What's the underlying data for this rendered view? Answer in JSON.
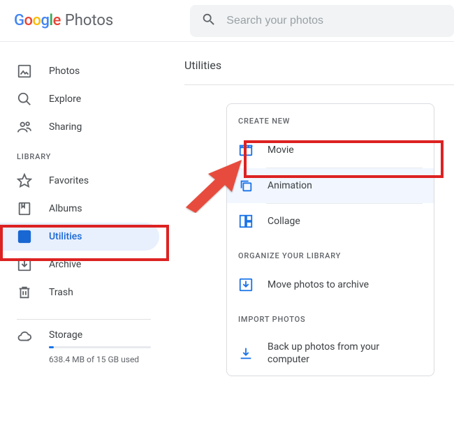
{
  "header": {
    "product_name": "Photos",
    "search_placeholder": "Search your photos"
  },
  "sidebar": {
    "items": [
      {
        "id": "photos",
        "label": "Photos",
        "icon": "image-icon"
      },
      {
        "id": "explore",
        "label": "Explore",
        "icon": "search-icon"
      },
      {
        "id": "sharing",
        "label": "Sharing",
        "icon": "people-icon"
      }
    ],
    "library_label": "LIBRARY",
    "library_items": [
      {
        "id": "favorites",
        "label": "Favorites",
        "icon": "star-icon"
      },
      {
        "id": "albums",
        "label": "Albums",
        "icon": "bookmark-icon"
      },
      {
        "id": "utilities",
        "label": "Utilities",
        "icon": "check-square-icon",
        "active": true
      },
      {
        "id": "archive",
        "label": "Archive",
        "icon": "archive-icon"
      },
      {
        "id": "trash",
        "label": "Trash",
        "icon": "trash-icon"
      }
    ],
    "storage": {
      "label": "Storage",
      "text": "638.4 MB of 15 GB used",
      "fill_pct": 5
    }
  },
  "main": {
    "title": "Utilities",
    "sections": {
      "create_new": {
        "label": "CREATE NEW",
        "items": [
          {
            "id": "movie",
            "label": "Movie",
            "icon": "clapper-icon"
          },
          {
            "id": "animation",
            "label": "Animation",
            "icon": "stack-icon",
            "highlight": true
          },
          {
            "id": "collage",
            "label": "Collage",
            "icon": "collage-icon"
          }
        ]
      },
      "organize": {
        "label": "ORGANIZE YOUR LIBRARY",
        "items": [
          {
            "id": "move-archive",
            "label": "Move photos to archive",
            "icon": "archive-down-icon"
          }
        ]
      },
      "import": {
        "label": "IMPORT PHOTOS",
        "items": [
          {
            "id": "backup",
            "label": "Back up photos from your computer",
            "icon": "download-icon"
          }
        ]
      }
    }
  },
  "colors": {
    "accent": "#1a73e8",
    "annotation": "#d22"
  }
}
